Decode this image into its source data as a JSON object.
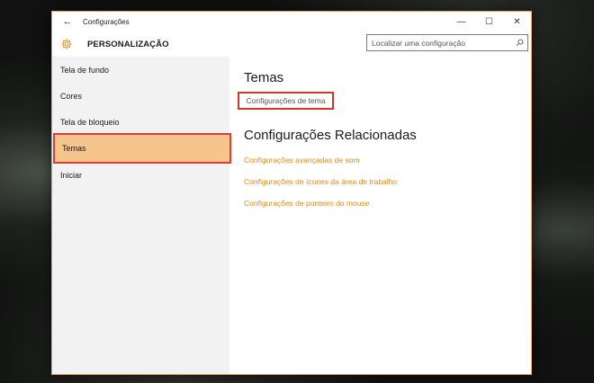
{
  "window": {
    "title": "Configurações",
    "back_glyph": "←",
    "minimize_glyph": "—",
    "maximize_glyph": "☐",
    "close_glyph": "✕"
  },
  "header": {
    "title": "PERSONALIZAÇÃO",
    "icon": "gear-icon",
    "search": {
      "placeholder": "Localizar uma configuração",
      "icon": "search-icon"
    }
  },
  "sidebar": {
    "items": [
      {
        "label": "Tela de fundo",
        "selected": false
      },
      {
        "label": "Cores",
        "selected": false
      },
      {
        "label": "Tela de bloqueio",
        "selected": false
      },
      {
        "label": "Temas",
        "selected": true
      },
      {
        "label": "Iniciar",
        "selected": false
      }
    ]
  },
  "main": {
    "section_title": "Temas",
    "theme_settings_link": "Configurações de tema",
    "related_title": "Configurações Relacionadas",
    "related_links": [
      "Configurações avançadas de som",
      "Configurações de ícones da área de trabalho",
      "Configurações de ponteiro do mouse"
    ]
  },
  "colors": {
    "accent": "#e8890f",
    "selection_fill": "#f6c48d",
    "highlight_border": "#dd3c2e",
    "sidebar_bg": "#f2f2f2"
  }
}
